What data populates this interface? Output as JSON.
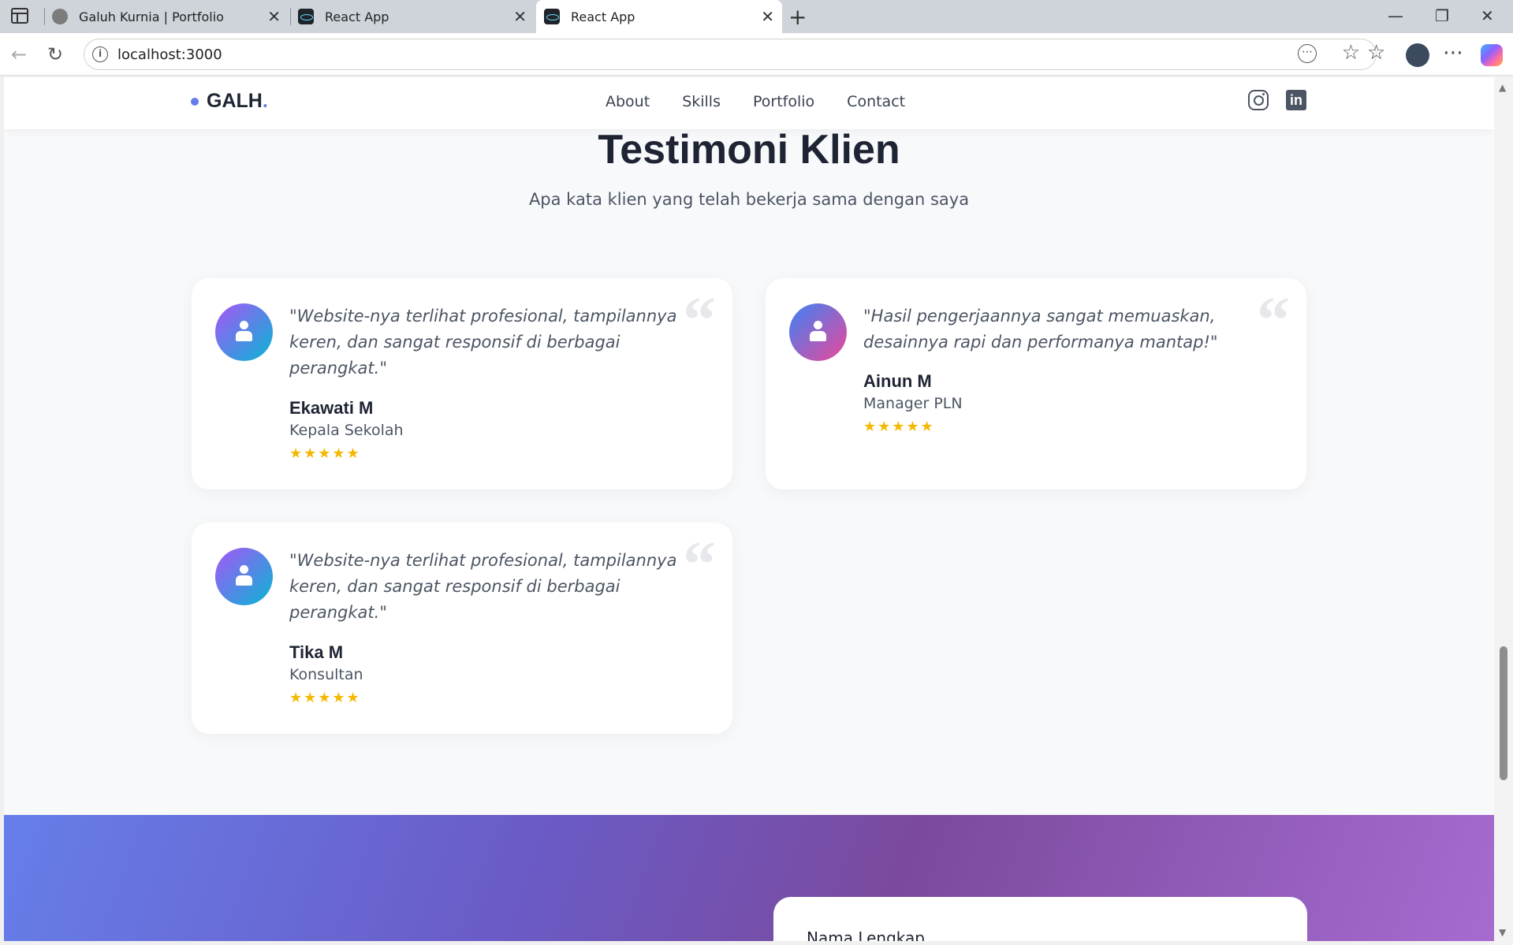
{
  "browser": {
    "tabs": [
      {
        "title": "Galuh Kurnia | Portfolio"
      },
      {
        "title": "React App"
      },
      {
        "title": "React App"
      }
    ],
    "url": "localhost:3000"
  },
  "site": {
    "logo": "GALH",
    "logo_period": ".",
    "nav": [
      "About",
      "Skills",
      "Portfolio",
      "Contact"
    ]
  },
  "section": {
    "title": "Testimoni Klien",
    "subtitle": "Apa kata klien yang telah bekerja sama dengan saya"
  },
  "testimonials": [
    {
      "quote": "\"Website-nya terlihat profesional, tampilannya keren, dan sangat responsif di berbagai perangkat.\"",
      "name": "Ekawati M",
      "role": "Kepala Sekolah",
      "rating": 5,
      "stars": "★★★★★"
    },
    {
      "quote": "\"Hasil pengerjaannya sangat memuaskan, desainnya rapi dan performanya mantap!\"",
      "name": "Ainun M",
      "role": "Manager PLN",
      "rating": 5,
      "stars": "★★★★★"
    },
    {
      "quote": "\"Website-nya terlihat profesional, tampilannya keren, dan sangat responsif di berbagai perangkat.\"",
      "name": "Tika M",
      "role": "Konsultan",
      "rating": 5,
      "stars": "★★★★★"
    }
  ],
  "contact": {
    "field_label": "Nama Lengkap"
  },
  "icons": {
    "quote": "quote-icon",
    "social": [
      "instagram-icon",
      "linkedin-icon"
    ]
  },
  "colors": {
    "accent": "#667eea",
    "star": "#f5b800",
    "heading": "#1e2433"
  }
}
